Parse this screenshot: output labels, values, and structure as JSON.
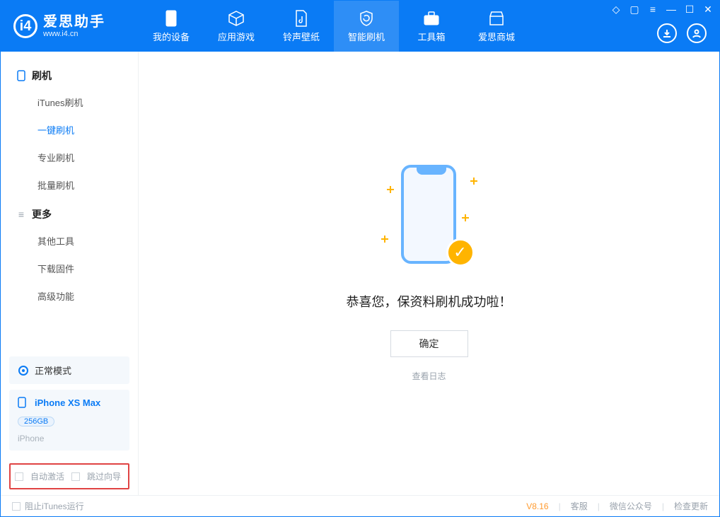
{
  "app": {
    "title": "爱思助手",
    "subtitle": "www.i4.cn"
  },
  "nav": {
    "items": [
      {
        "label": "我的设备"
      },
      {
        "label": "应用游戏"
      },
      {
        "label": "铃声壁纸"
      },
      {
        "label": "智能刷机"
      },
      {
        "label": "工具箱"
      },
      {
        "label": "爱思商城"
      }
    ]
  },
  "sidebar": {
    "sections": [
      {
        "title": "刷机",
        "items": [
          "iTunes刷机",
          "一键刷机",
          "专业刷机",
          "批量刷机"
        ],
        "selected": 1
      },
      {
        "title": "更多",
        "items": [
          "其他工具",
          "下载固件",
          "高级功能"
        ]
      }
    ],
    "mode_label": "正常模式",
    "device": {
      "name": "iPhone XS Max",
      "storage": "256GB",
      "type": "iPhone"
    },
    "options": {
      "auto_activate": "自动激活",
      "skip_guide": "跳过向导"
    }
  },
  "main": {
    "success_text": "恭喜您，保资料刷机成功啦！",
    "confirm_label": "确定",
    "log_link": "查看日志"
  },
  "footer": {
    "block_itunes": "阻止iTunes运行",
    "version": "V8.16",
    "links": [
      "客服",
      "微信公众号",
      "检查更新"
    ]
  }
}
